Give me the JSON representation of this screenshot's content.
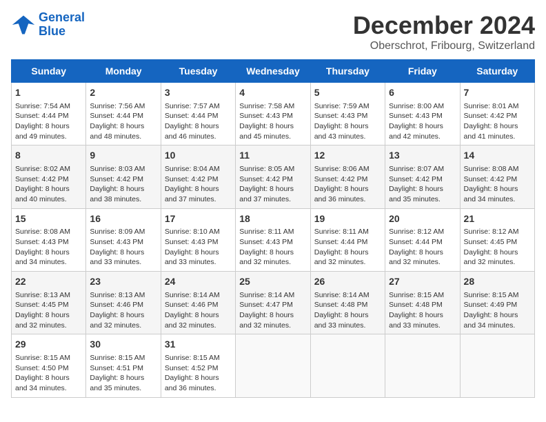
{
  "logo": {
    "line1": "General",
    "line2": "Blue"
  },
  "title": "December 2024",
  "subtitle": "Oberschrot, Fribourg, Switzerland",
  "days_of_week": [
    "Sunday",
    "Monday",
    "Tuesday",
    "Wednesday",
    "Thursday",
    "Friday",
    "Saturday"
  ],
  "weeks": [
    [
      {
        "day": "1",
        "info": "Sunrise: 7:54 AM\nSunset: 4:44 PM\nDaylight: 8 hours\nand 49 minutes."
      },
      {
        "day": "2",
        "info": "Sunrise: 7:56 AM\nSunset: 4:44 PM\nDaylight: 8 hours\nand 48 minutes."
      },
      {
        "day": "3",
        "info": "Sunrise: 7:57 AM\nSunset: 4:44 PM\nDaylight: 8 hours\nand 46 minutes."
      },
      {
        "day": "4",
        "info": "Sunrise: 7:58 AM\nSunset: 4:43 PM\nDaylight: 8 hours\nand 45 minutes."
      },
      {
        "day": "5",
        "info": "Sunrise: 7:59 AM\nSunset: 4:43 PM\nDaylight: 8 hours\nand 43 minutes."
      },
      {
        "day": "6",
        "info": "Sunrise: 8:00 AM\nSunset: 4:43 PM\nDaylight: 8 hours\nand 42 minutes."
      },
      {
        "day": "7",
        "info": "Sunrise: 8:01 AM\nSunset: 4:42 PM\nDaylight: 8 hours\nand 41 minutes."
      }
    ],
    [
      {
        "day": "8",
        "info": "Sunrise: 8:02 AM\nSunset: 4:42 PM\nDaylight: 8 hours\nand 40 minutes."
      },
      {
        "day": "9",
        "info": "Sunrise: 8:03 AM\nSunset: 4:42 PM\nDaylight: 8 hours\nand 38 minutes."
      },
      {
        "day": "10",
        "info": "Sunrise: 8:04 AM\nSunset: 4:42 PM\nDaylight: 8 hours\nand 37 minutes."
      },
      {
        "day": "11",
        "info": "Sunrise: 8:05 AM\nSunset: 4:42 PM\nDaylight: 8 hours\nand 37 minutes."
      },
      {
        "day": "12",
        "info": "Sunrise: 8:06 AM\nSunset: 4:42 PM\nDaylight: 8 hours\nand 36 minutes."
      },
      {
        "day": "13",
        "info": "Sunrise: 8:07 AM\nSunset: 4:42 PM\nDaylight: 8 hours\nand 35 minutes."
      },
      {
        "day": "14",
        "info": "Sunrise: 8:08 AM\nSunset: 4:42 PM\nDaylight: 8 hours\nand 34 minutes."
      }
    ],
    [
      {
        "day": "15",
        "info": "Sunrise: 8:08 AM\nSunset: 4:43 PM\nDaylight: 8 hours\nand 34 minutes."
      },
      {
        "day": "16",
        "info": "Sunrise: 8:09 AM\nSunset: 4:43 PM\nDaylight: 8 hours\nand 33 minutes."
      },
      {
        "day": "17",
        "info": "Sunrise: 8:10 AM\nSunset: 4:43 PM\nDaylight: 8 hours\nand 33 minutes."
      },
      {
        "day": "18",
        "info": "Sunrise: 8:11 AM\nSunset: 4:43 PM\nDaylight: 8 hours\nand 32 minutes."
      },
      {
        "day": "19",
        "info": "Sunrise: 8:11 AM\nSunset: 4:44 PM\nDaylight: 8 hours\nand 32 minutes."
      },
      {
        "day": "20",
        "info": "Sunrise: 8:12 AM\nSunset: 4:44 PM\nDaylight: 8 hours\nand 32 minutes."
      },
      {
        "day": "21",
        "info": "Sunrise: 8:12 AM\nSunset: 4:45 PM\nDaylight: 8 hours\nand 32 minutes."
      }
    ],
    [
      {
        "day": "22",
        "info": "Sunrise: 8:13 AM\nSunset: 4:45 PM\nDaylight: 8 hours\nand 32 minutes."
      },
      {
        "day": "23",
        "info": "Sunrise: 8:13 AM\nSunset: 4:46 PM\nDaylight: 8 hours\nand 32 minutes."
      },
      {
        "day": "24",
        "info": "Sunrise: 8:14 AM\nSunset: 4:46 PM\nDaylight: 8 hours\nand 32 minutes."
      },
      {
        "day": "25",
        "info": "Sunrise: 8:14 AM\nSunset: 4:47 PM\nDaylight: 8 hours\nand 32 minutes."
      },
      {
        "day": "26",
        "info": "Sunrise: 8:14 AM\nSunset: 4:48 PM\nDaylight: 8 hours\nand 33 minutes."
      },
      {
        "day": "27",
        "info": "Sunrise: 8:15 AM\nSunset: 4:48 PM\nDaylight: 8 hours\nand 33 minutes."
      },
      {
        "day": "28",
        "info": "Sunrise: 8:15 AM\nSunset: 4:49 PM\nDaylight: 8 hours\nand 34 minutes."
      }
    ],
    [
      {
        "day": "29",
        "info": "Sunrise: 8:15 AM\nSunset: 4:50 PM\nDaylight: 8 hours\nand 34 minutes."
      },
      {
        "day": "30",
        "info": "Sunrise: 8:15 AM\nSunset: 4:51 PM\nDaylight: 8 hours\nand 35 minutes."
      },
      {
        "day": "31",
        "info": "Sunrise: 8:15 AM\nSunset: 4:52 PM\nDaylight: 8 hours\nand 36 minutes."
      },
      {
        "day": "",
        "info": ""
      },
      {
        "day": "",
        "info": ""
      },
      {
        "day": "",
        "info": ""
      },
      {
        "day": "",
        "info": ""
      }
    ]
  ]
}
